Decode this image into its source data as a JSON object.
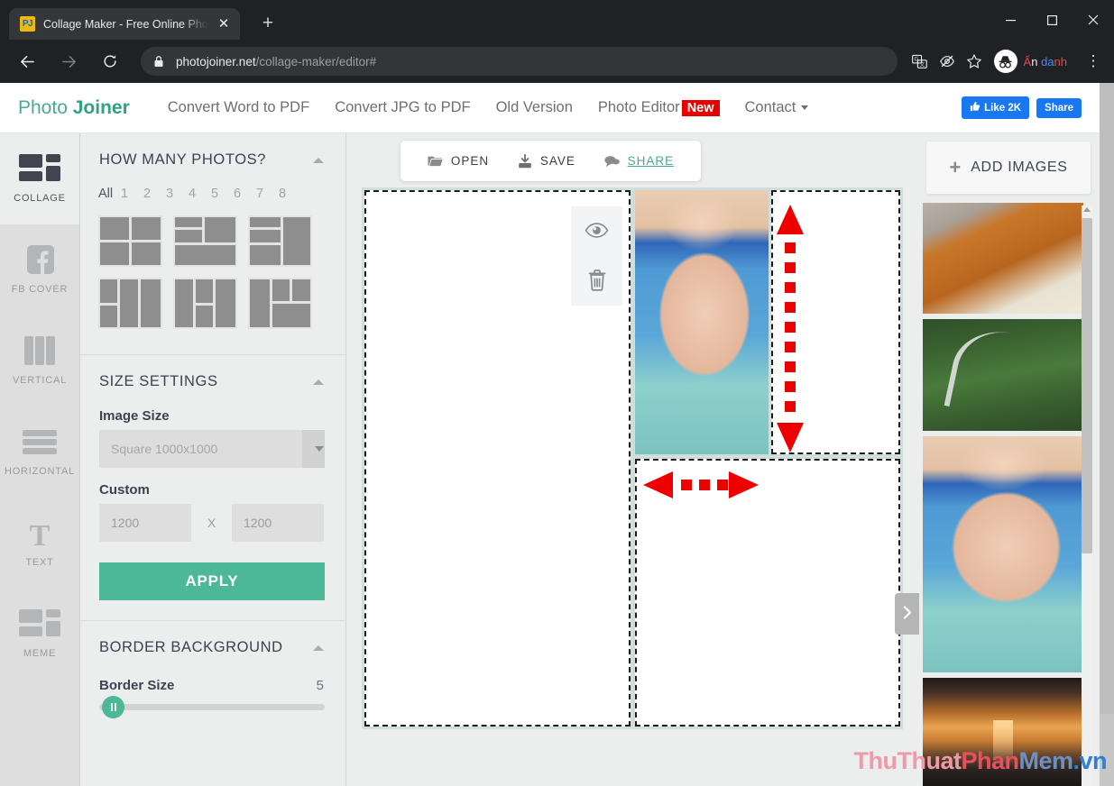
{
  "browser": {
    "tab": {
      "title": "Collage Maker - Free Online Phot",
      "favicon_text": "PJ",
      "close_icon": "close-icon"
    },
    "newtab_label": "+",
    "window_controls": {
      "minimize": "minimize-icon",
      "maximize": "maximize-icon",
      "close": "close-icon"
    },
    "omnibox": {
      "url_host": "photojoiner.net",
      "url_path": "/collage-maker/editor#",
      "lock_icon": "lock-icon",
      "translate_icon": "translate-icon",
      "eye-slash_icon": "eye-slash-icon",
      "star_icon": "star-icon"
    },
    "incognito": {
      "label": "Ẩn danh",
      "avatar_icon": "incognito-icon"
    },
    "menu_icon": "kebab-menu-icon",
    "back_icon": "arrow-left-icon",
    "forward_icon": "arrow-right-icon",
    "reload_icon": "reload-icon"
  },
  "sitenav": {
    "brand_first": "Photo",
    "brand_second": "Joiner",
    "links": [
      {
        "label": "Convert Word to PDF"
      },
      {
        "label": "Convert JPG to PDF"
      },
      {
        "label": "Old Version"
      },
      {
        "label": "Photo Editor",
        "badge": "New"
      },
      {
        "label": "Contact",
        "has_caret": true
      }
    ],
    "facebook_like": "Like 2K",
    "facebook_share": "Share"
  },
  "rail": {
    "items": [
      {
        "label": "COLLAGE",
        "icon": "collage-icon",
        "active": true
      },
      {
        "label": "FB COVER",
        "icon": "facebook-icon",
        "active": false
      },
      {
        "label": "VERTICAL",
        "icon": "vertical-columns-icon",
        "active": false
      },
      {
        "label": "HORIZONTAL",
        "icon": "horizontal-rows-icon",
        "active": false
      },
      {
        "label": "TEXT",
        "icon": "text-t-icon",
        "active": false
      },
      {
        "label": "MEME",
        "icon": "meme-icon",
        "active": false
      }
    ]
  },
  "left_panel": {
    "photos_section": {
      "title": "HOW MANY PHOTOS?",
      "collapse_icon": "chevron-up-icon",
      "counts": [
        "All",
        "1",
        "2",
        "3",
        "4",
        "5",
        "6",
        "7",
        "8"
      ],
      "selected_count": "All",
      "templates": [
        {
          "name": "template-2x2"
        },
        {
          "name": "template-left-split-bottom-bar"
        },
        {
          "name": "template-left-stack-right-big"
        },
        {
          "name": "template-3col-left-split"
        },
        {
          "name": "template-3col-mid-split"
        },
        {
          "name": "template-left-tall-right-grid"
        }
      ]
    },
    "size_section": {
      "title": "SIZE SETTINGS",
      "collapse_icon": "chevron-up-icon",
      "image_size_label": "Image Size",
      "image_size_value": "Square 1000x1000",
      "custom_label": "Custom",
      "custom_width": "1200",
      "custom_height": "1200",
      "x_separator": "X",
      "apply_label": "APPLY"
    },
    "border_section": {
      "title": "BORDER BACKGROUND",
      "collapse_icon": "chevron-up-icon",
      "border_size_label": "Border Size",
      "border_size_value": "5"
    }
  },
  "canvas_toolbar": {
    "open": {
      "label": "OPEN",
      "icon": "folder-open-icon"
    },
    "save": {
      "label": "SAVE",
      "icon": "download-icon"
    },
    "share": {
      "label": "SHARE",
      "icon": "comment-icon"
    }
  },
  "canvas": {
    "cell_overlay": {
      "preview_icon": "eye-icon",
      "delete_icon": "trash-icon"
    },
    "annotations": [
      {
        "name": "vertical-resize-arrow",
        "direction": "vertical",
        "color": "#ee0000"
      },
      {
        "name": "horizontal-resize-arrow",
        "direction": "horizontal",
        "color": "#ee0000"
      }
    ],
    "panel_toggle_icon": "chevron-right-icon"
  },
  "right_panel": {
    "add_images_label": "ADD IMAGES",
    "add_icon": "plus-icon",
    "thumbnails": [
      {
        "name": "thumb-book-pumpkins",
        "art": "ph-book"
      },
      {
        "name": "thumb-forest-road",
        "art": "ph-road"
      },
      {
        "name": "thumb-girl-pool",
        "art": "ph-girl"
      },
      {
        "name": "thumb-sunset-sea",
        "art": "ph-sunset"
      }
    ],
    "scroll_up_icon": "scroll-up-arrow-icon"
  },
  "watermark": {
    "p1": "ThuThuat",
    "p2": "Phan",
    "p3": "Mem",
    "p4": ".vn"
  },
  "colors": {
    "accent_green": "#4db898",
    "brand_green": "#2fa37f",
    "annotation_red": "#ee0000",
    "facebook_blue": "#1877f2",
    "badge_red": "#e80000"
  }
}
